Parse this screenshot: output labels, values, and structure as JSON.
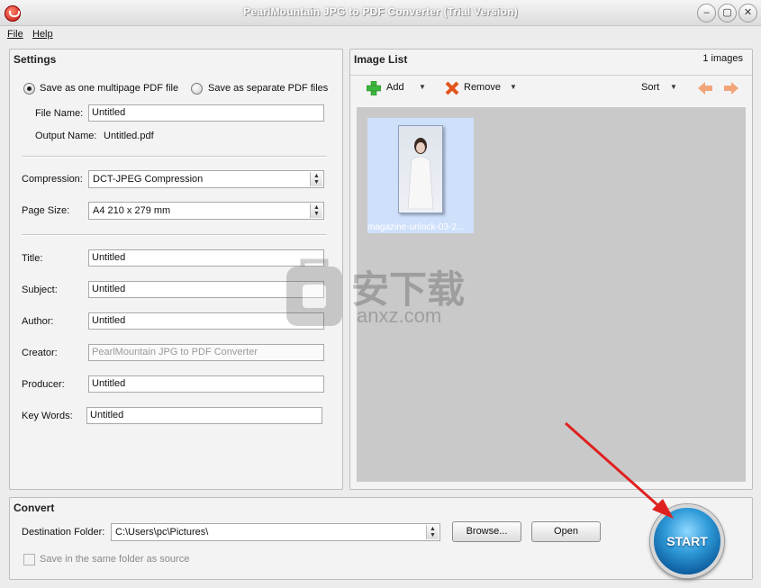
{
  "window": {
    "title": "PearlMountain JPG to PDF Converter (Trial Version)"
  },
  "menu": {
    "file": "File",
    "help": "Help"
  },
  "settings": {
    "title": "Settings",
    "radio_multipage": "Save as one multipage PDF file",
    "radio_separate": "Save as separate PDF files",
    "file_name_label": "File Name:",
    "file_name_value": "Untitled",
    "output_name_label": "Output Name:",
    "output_name_value": "Untitled.pdf",
    "compression_label": "Compression:",
    "compression_value": "DCT-JPEG Compression",
    "page_size_label": "Page Size:",
    "page_size_value": "A4 210 x 279 mm",
    "title_label": "Title:",
    "title_value": "Untitled",
    "subject_label": "Subject:",
    "subject_value": "Untitled",
    "author_label": "Author:",
    "author_value": "Untitled",
    "creator_label": "Creator:",
    "creator_value": "PearlMountain JPG to PDF Converter",
    "producer_label": "Producer:",
    "producer_value": "Untitled",
    "keywords_label": "Key Words:",
    "keywords_value": "Untitled"
  },
  "image_list": {
    "title": "Image List",
    "count": "1 images",
    "add": "Add",
    "remove": "Remove",
    "sort": "Sort",
    "items": [
      {
        "name": "magazine-unlock-03-2..."
      }
    ]
  },
  "convert": {
    "title": "Convert",
    "destination_label": "Destination Folder:",
    "destination_value": "C:\\Users\\pc\\Pictures\\",
    "browse": "Browse...",
    "open": "Open",
    "same_folder": "Save in the same folder as source",
    "start": "START"
  },
  "watermark": {
    "text": "安下载",
    "subtext": "anxz.com"
  },
  "colors": {
    "accent": "#2f9ad8",
    "annotation_arrow": "#e02020",
    "add_icon": "#3cb53c",
    "remove_icon": "#e2541c"
  }
}
